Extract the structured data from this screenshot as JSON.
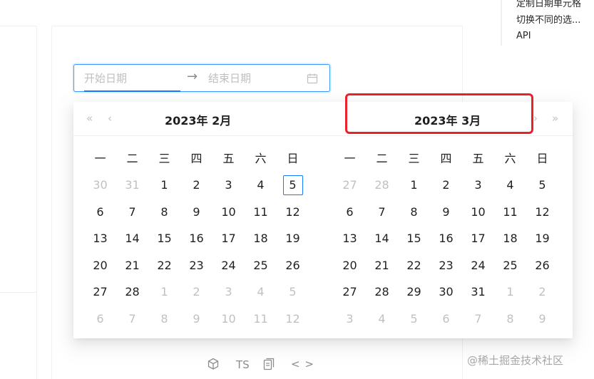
{
  "anchor_nav": {
    "items": [
      "定制日期单元格",
      "切换不同的选...",
      "API"
    ]
  },
  "range_picker": {
    "start_placeholder": "开始日期",
    "end_placeholder": "结束日期",
    "separator": "→"
  },
  "panel": {
    "nav": {
      "super_prev": "«",
      "prev": "‹",
      "next": "›",
      "super_next": "»"
    },
    "left": {
      "title": "2023年  2月",
      "weekdays": [
        "一",
        "二",
        "三",
        "四",
        "五",
        "六",
        "日"
      ],
      "days": [
        {
          "d": "30",
          "in": false
        },
        {
          "d": "31",
          "in": false
        },
        {
          "d": "1",
          "in": true
        },
        {
          "d": "2",
          "in": true
        },
        {
          "d": "3",
          "in": true
        },
        {
          "d": "4",
          "in": true
        },
        {
          "d": "5",
          "in": true,
          "today": true
        },
        {
          "d": "6",
          "in": true
        },
        {
          "d": "7",
          "in": true
        },
        {
          "d": "8",
          "in": true
        },
        {
          "d": "9",
          "in": true
        },
        {
          "d": "10",
          "in": true
        },
        {
          "d": "11",
          "in": true
        },
        {
          "d": "12",
          "in": true
        },
        {
          "d": "13",
          "in": true
        },
        {
          "d": "14",
          "in": true
        },
        {
          "d": "15",
          "in": true
        },
        {
          "d": "16",
          "in": true
        },
        {
          "d": "17",
          "in": true
        },
        {
          "d": "18",
          "in": true
        },
        {
          "d": "19",
          "in": true
        },
        {
          "d": "20",
          "in": true
        },
        {
          "d": "21",
          "in": true
        },
        {
          "d": "22",
          "in": true
        },
        {
          "d": "23",
          "in": true
        },
        {
          "d": "24",
          "in": true
        },
        {
          "d": "25",
          "in": true
        },
        {
          "d": "26",
          "in": true
        },
        {
          "d": "27",
          "in": true
        },
        {
          "d": "28",
          "in": true
        },
        {
          "d": "1",
          "in": false
        },
        {
          "d": "2",
          "in": false
        },
        {
          "d": "3",
          "in": false
        },
        {
          "d": "4",
          "in": false
        },
        {
          "d": "5",
          "in": false
        },
        {
          "d": "6",
          "in": false
        },
        {
          "d": "7",
          "in": false
        },
        {
          "d": "8",
          "in": false
        },
        {
          "d": "9",
          "in": false
        },
        {
          "d": "10",
          "in": false
        },
        {
          "d": "11",
          "in": false
        },
        {
          "d": "12",
          "in": false
        }
      ]
    },
    "right": {
      "title": "2023年  3月",
      "weekdays": [
        "一",
        "二",
        "三",
        "四",
        "五",
        "六",
        "日"
      ],
      "days": [
        {
          "d": "27",
          "in": false
        },
        {
          "d": "28",
          "in": false
        },
        {
          "d": "1",
          "in": true
        },
        {
          "d": "2",
          "in": true
        },
        {
          "d": "3",
          "in": true
        },
        {
          "d": "4",
          "in": true
        },
        {
          "d": "5",
          "in": true
        },
        {
          "d": "6",
          "in": true
        },
        {
          "d": "7",
          "in": true
        },
        {
          "d": "8",
          "in": true
        },
        {
          "d": "9",
          "in": true
        },
        {
          "d": "10",
          "in": true
        },
        {
          "d": "11",
          "in": true
        },
        {
          "d": "12",
          "in": true
        },
        {
          "d": "13",
          "in": true
        },
        {
          "d": "14",
          "in": true
        },
        {
          "d": "15",
          "in": true
        },
        {
          "d": "16",
          "in": true
        },
        {
          "d": "17",
          "in": true
        },
        {
          "d": "18",
          "in": true
        },
        {
          "d": "19",
          "in": true
        },
        {
          "d": "20",
          "in": true
        },
        {
          "d": "21",
          "in": true
        },
        {
          "d": "22",
          "in": true
        },
        {
          "d": "23",
          "in": true
        },
        {
          "d": "24",
          "in": true
        },
        {
          "d": "25",
          "in": true
        },
        {
          "d": "26",
          "in": true
        },
        {
          "d": "27",
          "in": true
        },
        {
          "d": "28",
          "in": true
        },
        {
          "d": "29",
          "in": true
        },
        {
          "d": "30",
          "in": true
        },
        {
          "d": "31",
          "in": true
        },
        {
          "d": "1",
          "in": false
        },
        {
          "d": "2",
          "in": false
        },
        {
          "d": "3",
          "in": false
        },
        {
          "d": "4",
          "in": false
        },
        {
          "d": "5",
          "in": false
        },
        {
          "d": "6",
          "in": false
        },
        {
          "d": "7",
          "in": false
        },
        {
          "d": "8",
          "in": false
        },
        {
          "d": "9",
          "in": false
        }
      ]
    }
  },
  "toolbar": {
    "icons": [
      "codesandbox-icon",
      "ts-icon",
      "copy-icon",
      "code-icon"
    ],
    "ts_label": "TS",
    "code_label": "< >"
  },
  "watermark": "@稀土掘金技术社区",
  "colors": {
    "primary": "#1677ff",
    "highlight": "#e8222b",
    "muted": "#bfbfbf"
  }
}
